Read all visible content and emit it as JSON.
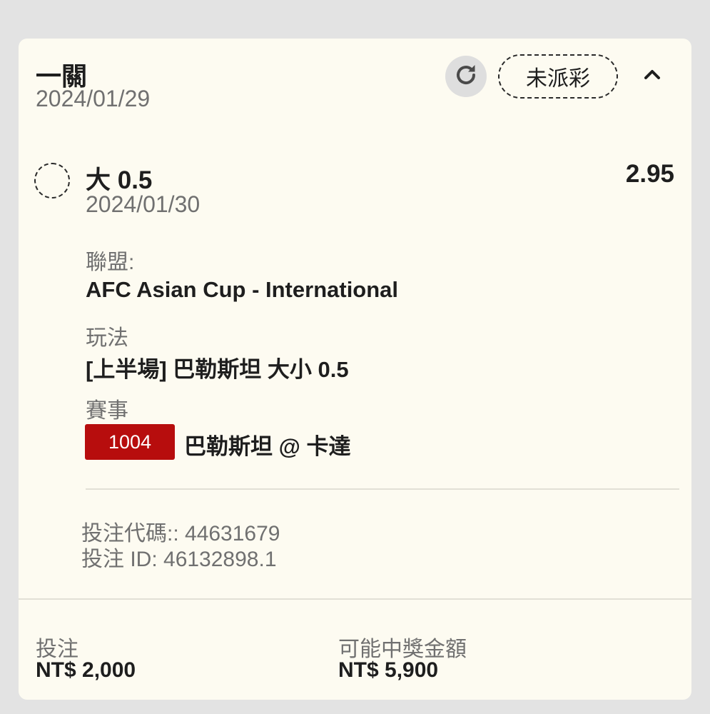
{
  "bet": {
    "type_title": "一關",
    "date": "2024/01/29",
    "status": "未派彩",
    "icons": {
      "refresh": "refresh-icon",
      "collapse": "chevron-up-icon"
    }
  },
  "selection": {
    "name": "大 0.5",
    "odds": "2.95",
    "date": "2024/01/30",
    "league_label": "聯盟:",
    "league": "AFC Asian Cup - International",
    "market_label": "玩法",
    "market": "[上半場] 巴勒斯坦 大小 0.5",
    "event_label": "賽事",
    "event_code": "1004",
    "event_name": "巴勒斯坦 @ 卡達"
  },
  "meta": {
    "bet_code": "投注代碼:: 44631679",
    "bet_id": "投注 ID: 46132898.1"
  },
  "footer": {
    "stake_label": "投注",
    "stake_value": "NT$ 2,000",
    "payout_label": "可能中獎金額",
    "payout_value": "NT$ 5,900"
  },
  "colors": {
    "card_bg": "#fdfbf1",
    "page_bg": "#e3e3e3",
    "event_code_bg": "#b70d0d",
    "muted_text": "#707070",
    "primary_text": "#1e1e1e"
  }
}
